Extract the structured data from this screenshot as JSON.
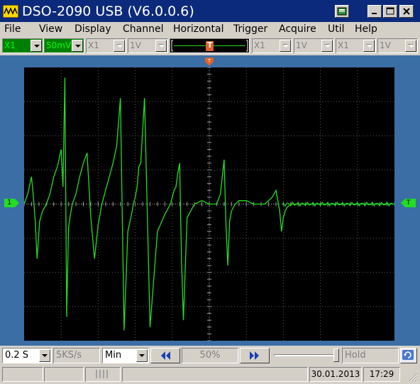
{
  "window": {
    "title": "DSO-2090 USB (V6.0.0.6)"
  },
  "menu": [
    "File",
    "View",
    "Display",
    "Channel",
    "Horizontal",
    "Trigger",
    "Acquire",
    "Util",
    "Help"
  ],
  "controls": {
    "ch1_probe": "X1",
    "ch1_volts": "50mV",
    "ch2_probe": "X1",
    "ch2_volts": "1V",
    "math_probe": "X1",
    "math_volts": "1V",
    "ref_probe": "X1",
    "ref_volts": "1V",
    "trigger_marker": "T"
  },
  "markers": {
    "ch1_level": "1",
    "trigger_level": "T"
  },
  "bottom": {
    "timebase": "0.2 S",
    "samplerate": "5KS/s",
    "mode": "Min",
    "position": "50%",
    "hold": "Hold"
  },
  "status": {
    "date": "30.01.2013",
    "time": "17:29"
  },
  "colors": {
    "trace": "#22dd22",
    "title_bar": "#0c2a7c",
    "scope_bg": "#3a6ea5",
    "screen": "#000000"
  },
  "chart_data": {
    "type": "line",
    "title": "",
    "xlabel": "",
    "ylabel": "",
    "divisions": {
      "x": 10,
      "y": 8
    },
    "xlim": [
      0,
      10
    ],
    "ylim": [
      -4,
      4
    ],
    "grid": true,
    "series": [
      {
        "x": [
          0,
          0.1,
          0.2,
          0.25,
          0.3,
          0.35,
          0.42,
          0.5,
          0.6,
          0.7,
          0.8,
          0.9,
          1.0,
          1.05,
          1.1,
          1.15,
          1.2,
          1.25,
          1.3,
          1.4,
          1.5,
          1.6,
          1.7,
          1.8,
          1.9,
          2.0,
          2.05,
          2.1,
          2.15,
          2.2,
          2.3,
          2.4,
          2.5,
          2.6,
          2.7,
          2.8,
          2.9,
          2.95,
          3.0,
          3.05,
          3.1,
          3.15,
          3.25,
          3.4,
          3.6,
          3.8,
          3.9,
          3.95,
          4.0,
          4.05,
          4.1,
          4.15,
          4.2,
          4.25,
          4.3,
          4.4,
          4.5,
          4.6,
          4.8,
          5.0,
          5.2,
          5.3,
          5.4,
          5.45,
          5.5,
          5.55,
          5.6,
          5.7,
          5.8,
          6.0,
          6.2,
          6.5,
          6.7,
          6.8,
          6.9,
          6.95,
          7.0,
          7.05,
          7.1,
          7.2,
          7.3,
          7.5,
          8.0,
          8.5,
          9.0,
          9.5,
          10.0
        ],
        "y": [
          0,
          0.3,
          0.8,
          0.2,
          -0.5,
          -1.6,
          -0.5,
          -0.2,
          0,
          0.3,
          0.8,
          1.1,
          1.6,
          0.5,
          3.7,
          -3.3,
          -0.7,
          -0.3,
          0,
          0.3,
          0.8,
          1.2,
          1.5,
          -0.4,
          -1.6,
          -0.6,
          -0.3,
          0,
          0.2,
          0.4,
          0.8,
          1.2,
          1.7,
          3.1,
          -3.7,
          -0.8,
          -0.3,
          0,
          0.2,
          0.5,
          1.1,
          1.2,
          3.1,
          -3.6,
          -0.8,
          -0.3,
          -0.1,
          0,
          0.2,
          0.4,
          0.5,
          0.9,
          1.2,
          -1.6,
          -3.4,
          -0.4,
          -0.2,
          0,
          0.1,
          0,
          0,
          0.3,
          1.3,
          -0.6,
          -1.8,
          -0.5,
          -0.2,
          0,
          0.1,
          0.1,
          0,
          0,
          0.2,
          0.4,
          -0.2,
          -0.8,
          -0.4,
          -0.2,
          -0.1,
          0,
          0,
          0,
          0,
          0,
          0,
          0,
          0
        ]
      }
    ]
  }
}
